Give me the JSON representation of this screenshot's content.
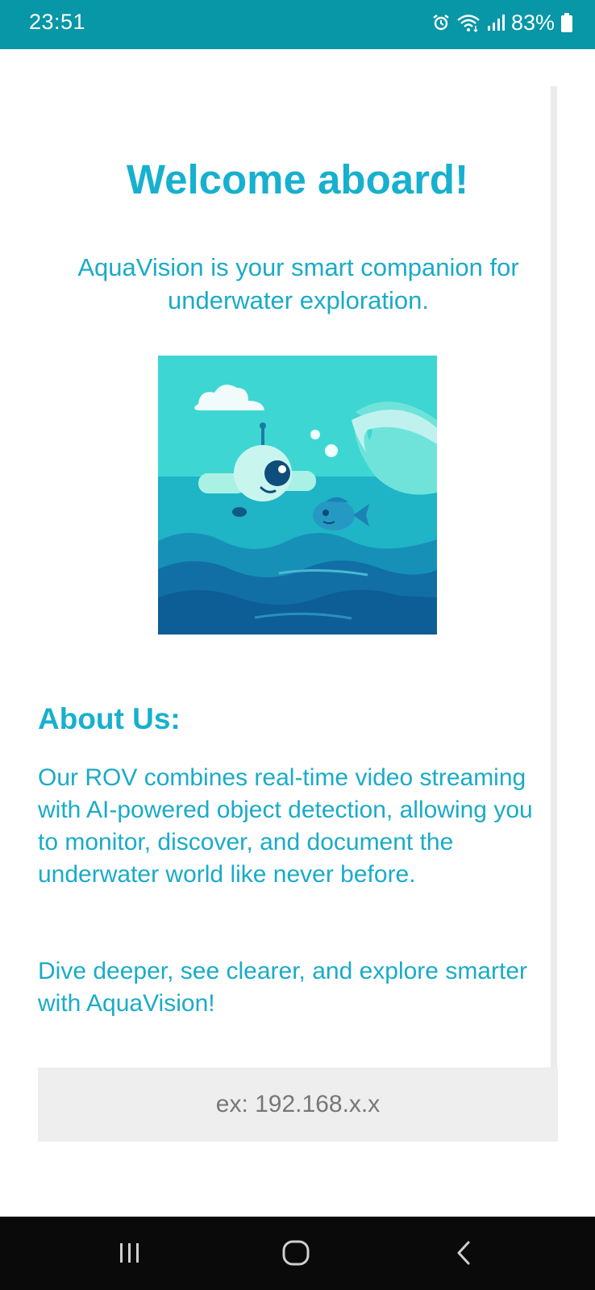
{
  "status_bar": {
    "time": "23:51",
    "battery": "83%",
    "icons": [
      "alarm-icon",
      "wifi-icon",
      "signal-icon",
      "battery-icon"
    ]
  },
  "main": {
    "title": "Welcome aboard!",
    "subtitle": "AquaVision is your smart companion for underwater exploration.",
    "hero_image": "ocean-illustration",
    "about_heading": "About Us:",
    "about_body": "Our ROV combines real-time video streaming with AI-powered object detection, allowing you to monitor, discover, and document the underwater world like never before.",
    "tagline": "Dive deeper, see clearer, and explore smarter with AquaVision!",
    "ip_input": {
      "value": "",
      "placeholder": "ex: 192.168.x.x"
    }
  },
  "nav_bar": {
    "buttons": [
      "recent-apps-icon",
      "home-icon",
      "back-icon"
    ]
  },
  "colors": {
    "status_bar": "#0797A6",
    "accent": "#17B0CE",
    "input_bg": "#EEEEEE",
    "nav_bar": "#0A0A0A"
  }
}
